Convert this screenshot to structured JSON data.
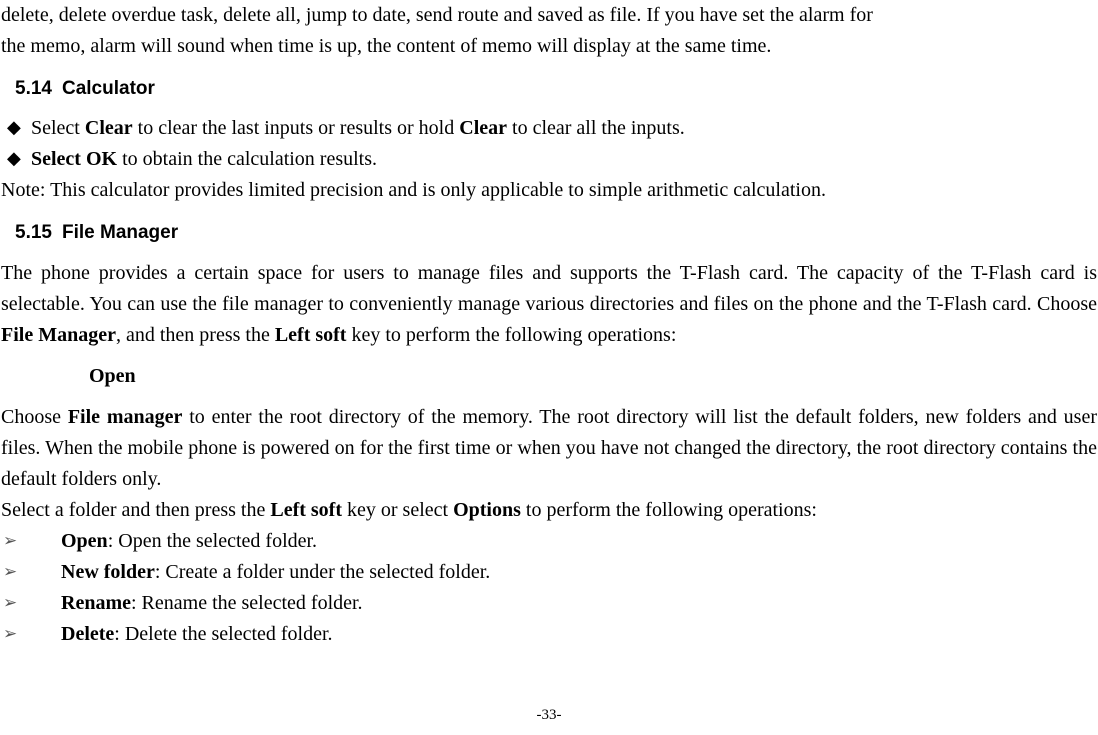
{
  "intro": {
    "line1": "delete, delete overdue task, delete all, jump to date, send route and saved as file. If you have set the alarm for",
    "line2": "the memo, alarm will sound when time is up, the content of memo will display at the same time."
  },
  "sections": {
    "calculator": {
      "num": "5.14",
      "title": "Calculator",
      "bullet1_pre": "Select ",
      "bullet1_b1": "Clear",
      "bullet1_mid": " to clear the last inputs or results or hold ",
      "bullet1_b2": "Clear",
      "bullet1_post": " to clear all the inputs.",
      "bullet2_bold": "Select OK",
      "bullet2_post": " to obtain the calculation results.",
      "note": "Note: This calculator provides limited precision and is only applicable to simple arithmetic calculation."
    },
    "filemgr": {
      "num": "5.15",
      "title": "File Manager",
      "para_pre": "The phone provides a certain space for users to manage files and supports the T-Flash card. The capacity of the T-Flash card is selectable. You can use the file manager to conveniently manage various directories and files on the phone and the T-Flash card. Choose ",
      "para_b1": "File Manager",
      "para_mid": ", and then press the ",
      "para_b2": "Left soft",
      "para_post": " key to perform the following operations:",
      "open_heading": "Open",
      "p2_pre": "Choose ",
      "p2_b1": "File manager",
      "p2_post": " to enter the root directory of the memory. The root directory will list the default folders, new folders and user files. When the mobile phone is powered on for the first time or when you have not changed the directory, the root directory contains the default folders only.",
      "p3_pre": "Select a folder and then press the ",
      "p3_b1": "Left soft",
      "p3_mid": " key or select ",
      "p3_b2": "Options",
      "p3_post": " to perform the following operations:",
      "ops": {
        "open_b": "Open",
        "open_t": ": Open the selected folder.",
        "newf_b": "New folder",
        "newf_t": ": Create a folder under the selected folder.",
        "ren_b": "Rename",
        "ren_t": ": Rename the selected folder.",
        "del_b": "Delete",
        "del_t": ": Delete the selected folder."
      }
    }
  },
  "page_number": "-33-"
}
